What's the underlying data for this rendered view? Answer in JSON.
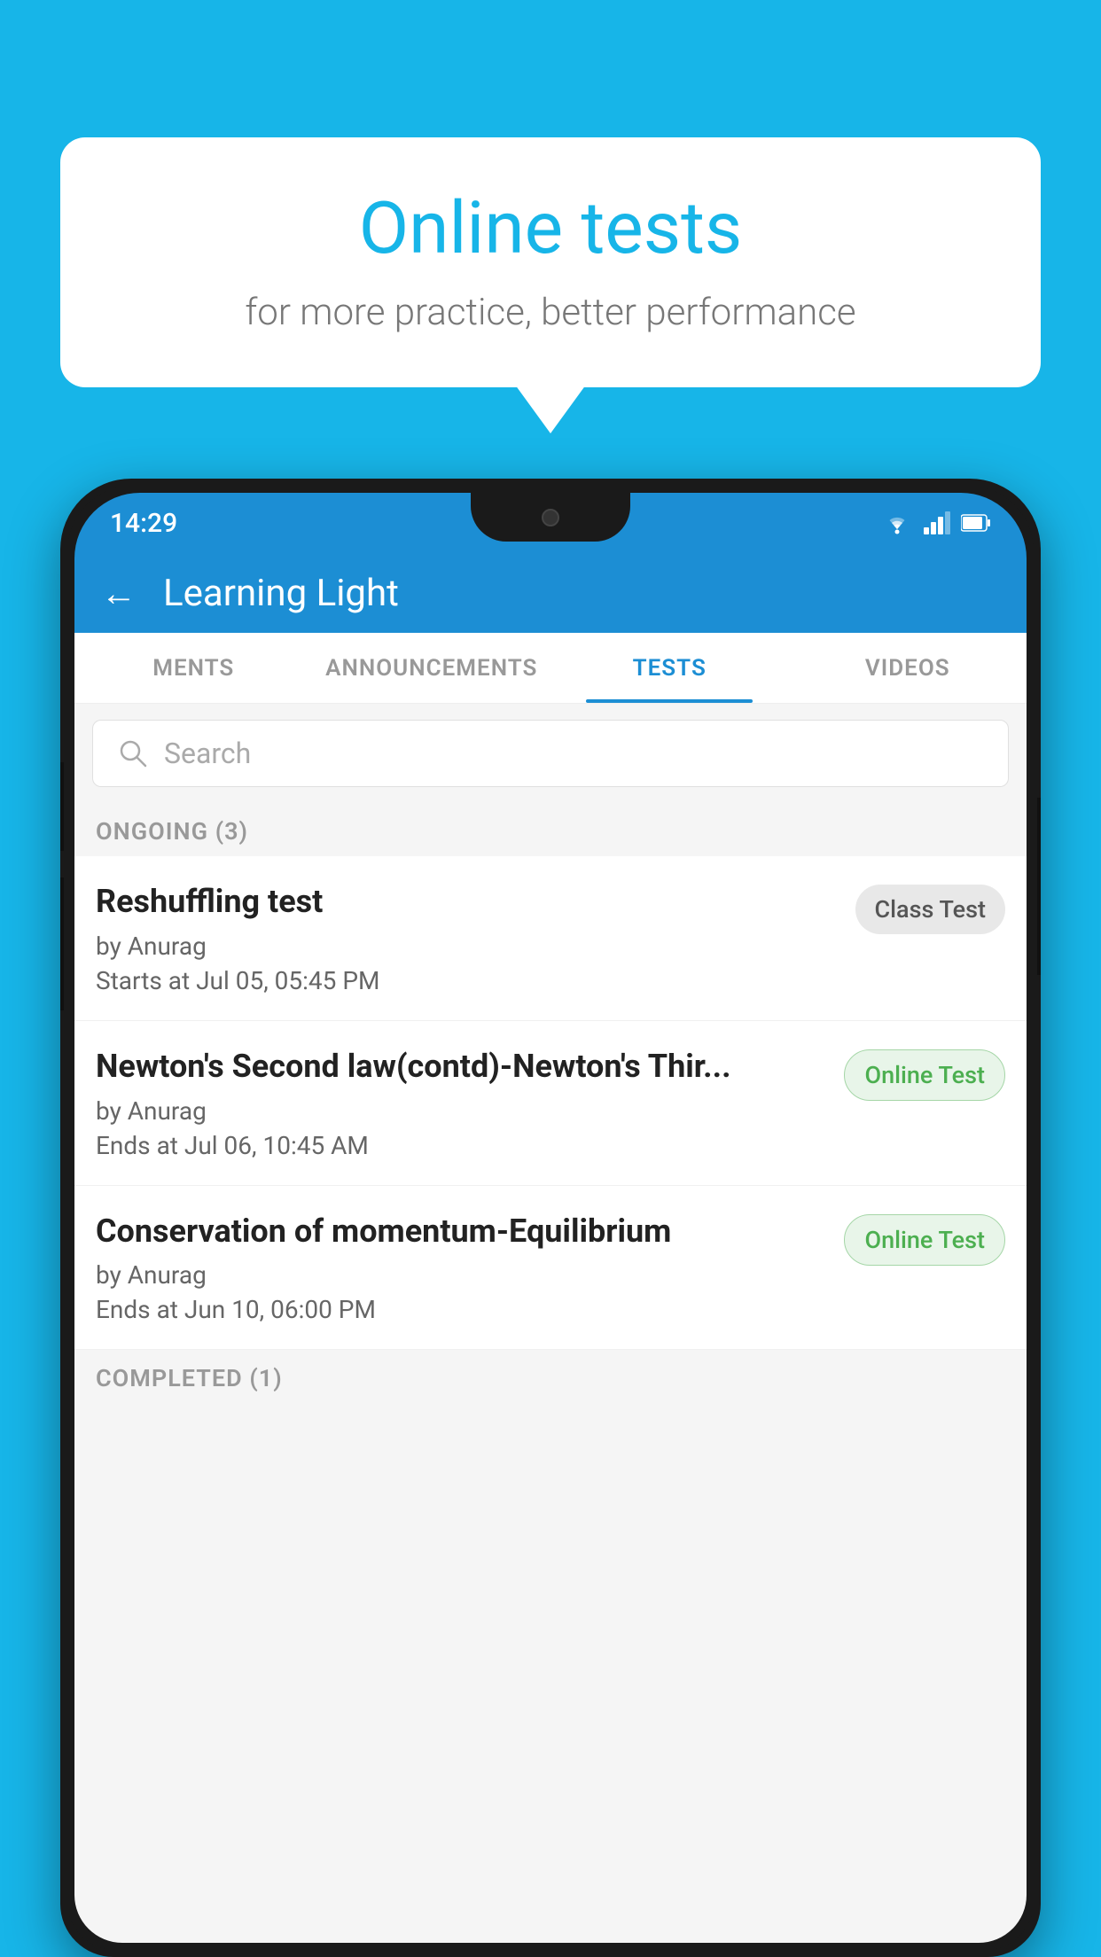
{
  "background_color": "#17B5E8",
  "bubble": {
    "title": "Online tests",
    "subtitle": "for more practice, better performance"
  },
  "status_bar": {
    "time": "14:29",
    "icons": [
      "wifi",
      "signal",
      "battery"
    ]
  },
  "app": {
    "title": "Learning Light",
    "back_label": "←"
  },
  "tabs": [
    {
      "label": "MENTS",
      "active": false
    },
    {
      "label": "ANNOUNCEMENTS",
      "active": false
    },
    {
      "label": "TESTS",
      "active": true
    },
    {
      "label": "VIDEOS",
      "active": false
    }
  ],
  "search": {
    "placeholder": "Search"
  },
  "ongoing_section": {
    "label": "ONGOING (3)"
  },
  "tests": [
    {
      "name": "Reshuffling test",
      "by": "by Anurag",
      "date": "Starts at  Jul 05, 05:45 PM",
      "badge": "Class Test",
      "badge_type": "class"
    },
    {
      "name": "Newton's Second law(contd)-Newton's Thir...",
      "by": "by Anurag",
      "date": "Ends at  Jul 06, 10:45 AM",
      "badge": "Online Test",
      "badge_type": "online"
    },
    {
      "name": "Conservation of momentum-Equilibrium",
      "by": "by Anurag",
      "date": "Ends at  Jun 10, 06:00 PM",
      "badge": "Online Test",
      "badge_type": "online"
    }
  ],
  "completed_section": {
    "label": "COMPLETED (1)"
  }
}
